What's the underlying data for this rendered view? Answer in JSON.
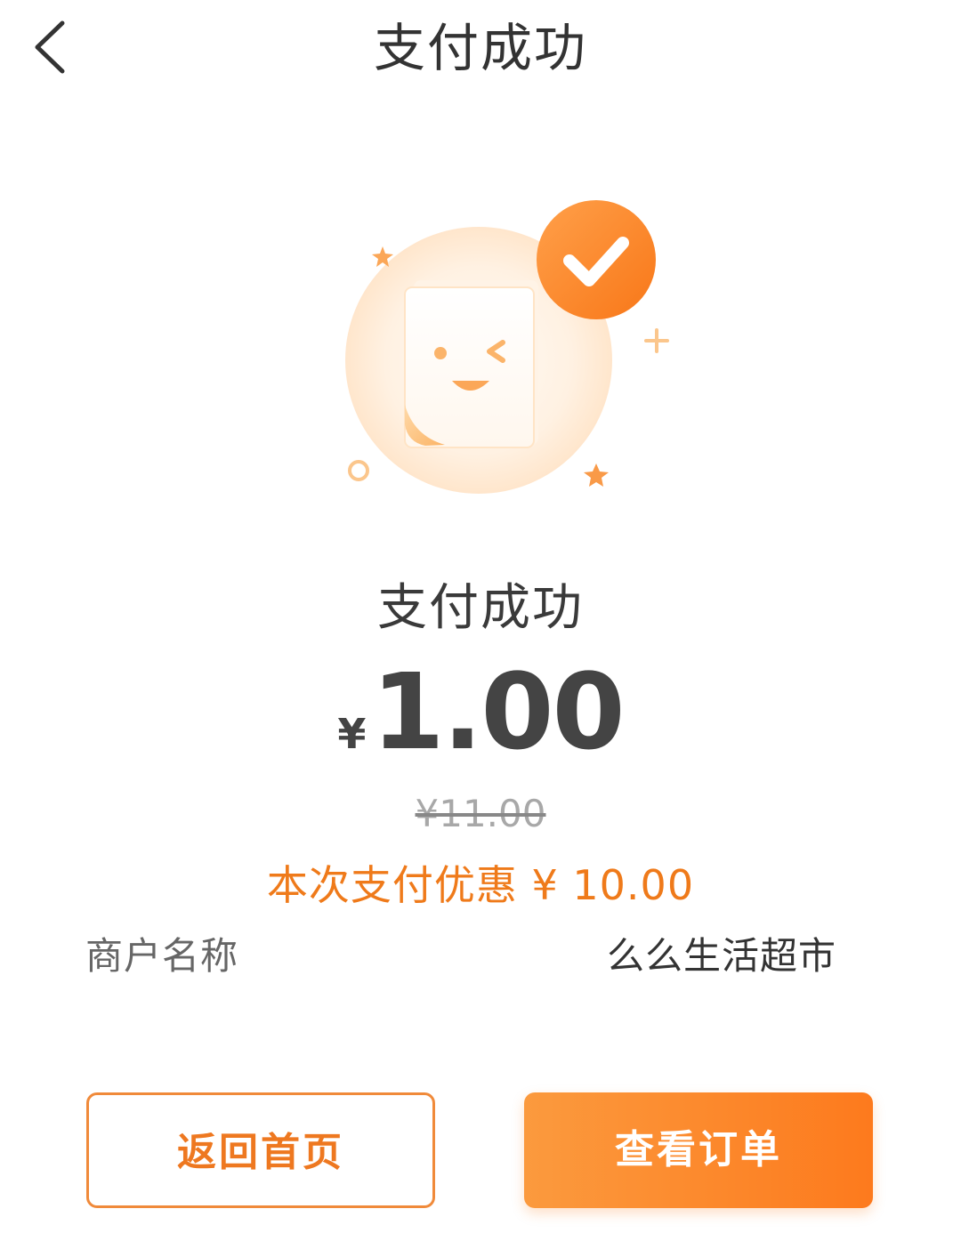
{
  "header": {
    "title": "支付成功"
  },
  "result": {
    "status": "支付成功",
    "currency_symbol": "¥",
    "amount": "1.00",
    "original_price": "¥11.00",
    "discount_text": "本次支付优惠 ¥ 10.00"
  },
  "merchant": {
    "label": "商户名称",
    "value": "么么生活超市"
  },
  "buttons": {
    "home_label": "返回首页",
    "order_label": "查看订单"
  },
  "colors": {
    "accent": "#fd7a1d",
    "discount": "#ef7a1a",
    "title_text": "#333333",
    "amount_text": "#444444"
  },
  "icons": {
    "back": "chevron-left-icon",
    "success": "checkmark-icon"
  }
}
